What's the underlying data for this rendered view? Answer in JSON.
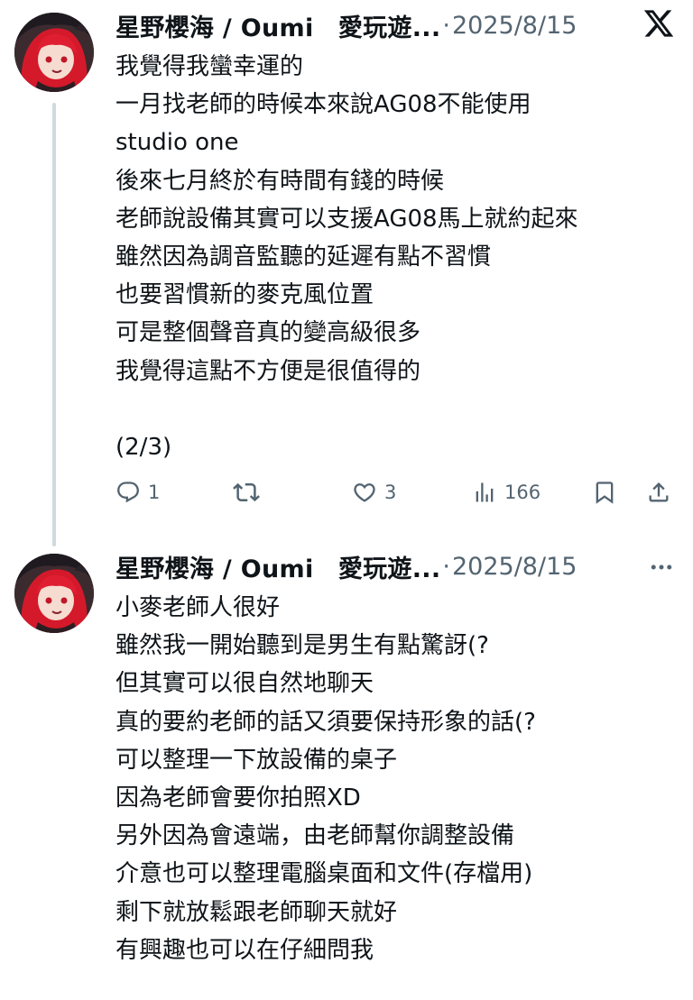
{
  "tweets": [
    {
      "author": {
        "display_name": "星野櫻海 / Oumi　愛玩遊...",
        "avatar": "anime-avatar-red-hair"
      },
      "separator": "·",
      "date": "2025/8/15",
      "corner_icon": "x-logo-icon",
      "lines": [
        "我覺得我蠻幸運的",
        "一月找老師的時候本來說AG08不能使用",
        "studio one",
        "後來七月終於有時間有錢的時候",
        "老師說設備其實可以支援AG08馬上就約起來",
        "雖然因為調音監聽的延遲有點不習慣",
        "也要習慣新的麥克風位置",
        "可是整個聲音真的變高級很多",
        "我覺得這點不方便是很值得的",
        "",
        "(2/3)"
      ],
      "actions": {
        "reply": {
          "icon": "reply-icon",
          "count": "1"
        },
        "retweet": {
          "icon": "retweet-icon",
          "count": ""
        },
        "like": {
          "icon": "heart-icon",
          "count": "3"
        },
        "views": {
          "icon": "views-icon",
          "count": "166"
        },
        "bookmark": {
          "icon": "bookmark-icon"
        },
        "share": {
          "icon": "share-icon"
        }
      }
    },
    {
      "author": {
        "display_name": "星野櫻海 / Oumi　愛玩遊...",
        "avatar": "anime-avatar-red-hair"
      },
      "separator": "·",
      "date": "2025/8/15",
      "corner_icon": "more-options-icon",
      "lines": [
        "小麥老師人很好",
        "雖然我一開始聽到是男生有點驚訝(?",
        "但其實可以很自然地聊天",
        "真的要約老師的話又須要保持形象的話(?",
        "可以整理一下放設備的桌子",
        "因為老師會要你拍照XD",
        "另外因為會遠端，由老師幫你調整設備",
        "介意也可以整理電腦桌面和文件(存檔用)",
        "剩下就放鬆跟老師聊天就好",
        "有興趣也可以在仔細問我"
      ]
    }
  ],
  "colors": {
    "text": "#0f1419",
    "secondary": "#536471",
    "thread_line": "#cfd9de",
    "background": "#ffffff"
  }
}
